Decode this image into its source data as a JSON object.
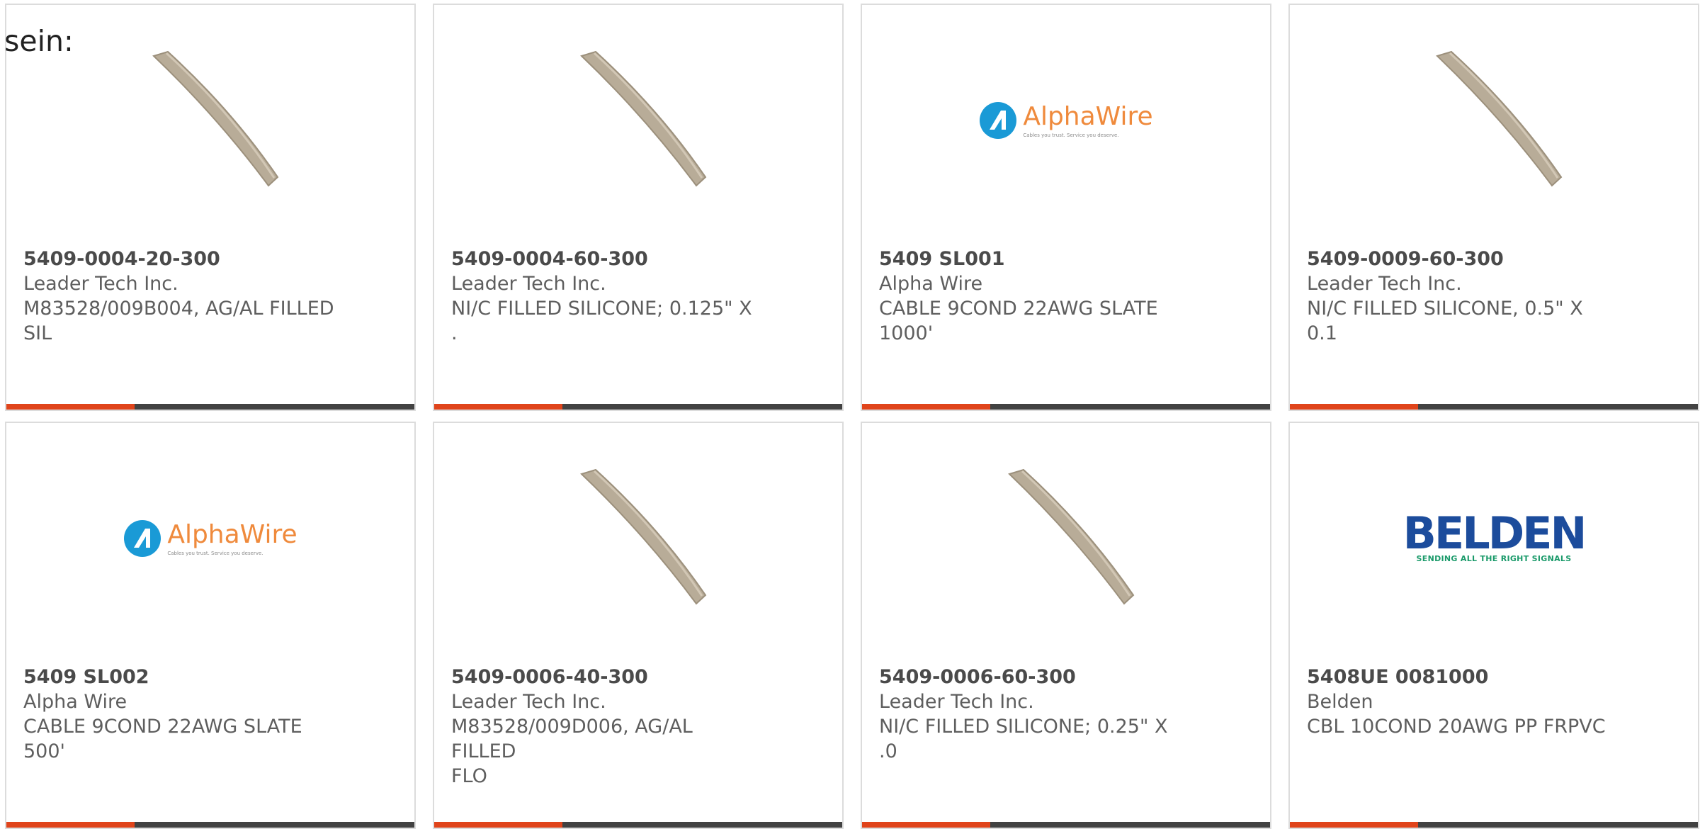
{
  "intro_text": "sein:",
  "accent_color": "#e0441b",
  "bar_color": "#424242",
  "products": [
    {
      "part_number": "5409-0004-20-300",
      "manufacturer": "Leader Tech Inc.",
      "desc_line1": "M83528/009B004, AG/AL FILLED",
      "desc_line2": "SIL",
      "image": "tube-image"
    },
    {
      "part_number": "5409-0004-60-300",
      "manufacturer": "Leader Tech Inc.",
      "desc_line1": "NI/C FILLED SILICONE; 0.125\" X",
      "desc_line2": ".",
      "image": "tube-image"
    },
    {
      "part_number": "5409 SL001",
      "manufacturer": "Alpha Wire",
      "desc_line1": "CABLE 9COND 22AWG SLATE",
      "desc_line2": "1000'",
      "image": "alphawire-logo",
      "logo_text": "AlphaWire",
      "logo_tagline": "Cables you trust. Service you deserve."
    },
    {
      "part_number": "5409-0009-60-300",
      "manufacturer": "Leader Tech Inc.",
      "desc_line1": "NI/C FILLED SILICONE, 0.5\" X",
      "desc_line2": "0.1",
      "image": "tube-image"
    },
    {
      "part_number": "5409 SL002",
      "manufacturer": "Alpha Wire",
      "desc_line1": "CABLE 9COND 22AWG SLATE",
      "desc_line2": "500'",
      "image": "alphawire-logo",
      "logo_text": "AlphaWire",
      "logo_tagline": "Cables you trust. Service you deserve."
    },
    {
      "part_number": "5409-0006-40-300",
      "manufacturer": "Leader Tech Inc.",
      "desc_line1": "M83528/009D006, AG/AL FILLED",
      "desc_line2": "FLO",
      "image": "tube-image"
    },
    {
      "part_number": "5409-0006-60-300",
      "manufacturer": "Leader Tech Inc.",
      "desc_line1": "NI/C FILLED SILICONE; 0.25\" X",
      "desc_line2": ".0",
      "image": "tube-image"
    },
    {
      "part_number": "5408UE 0081000",
      "manufacturer": "Belden",
      "desc_line1": "CBL 10COND 20AWG PP FRPVC",
      "desc_line2": "",
      "image": "belden-logo",
      "logo_text": "BELDEN",
      "logo_tagline": "SENDING ALL THE RIGHT SIGNALS"
    }
  ]
}
